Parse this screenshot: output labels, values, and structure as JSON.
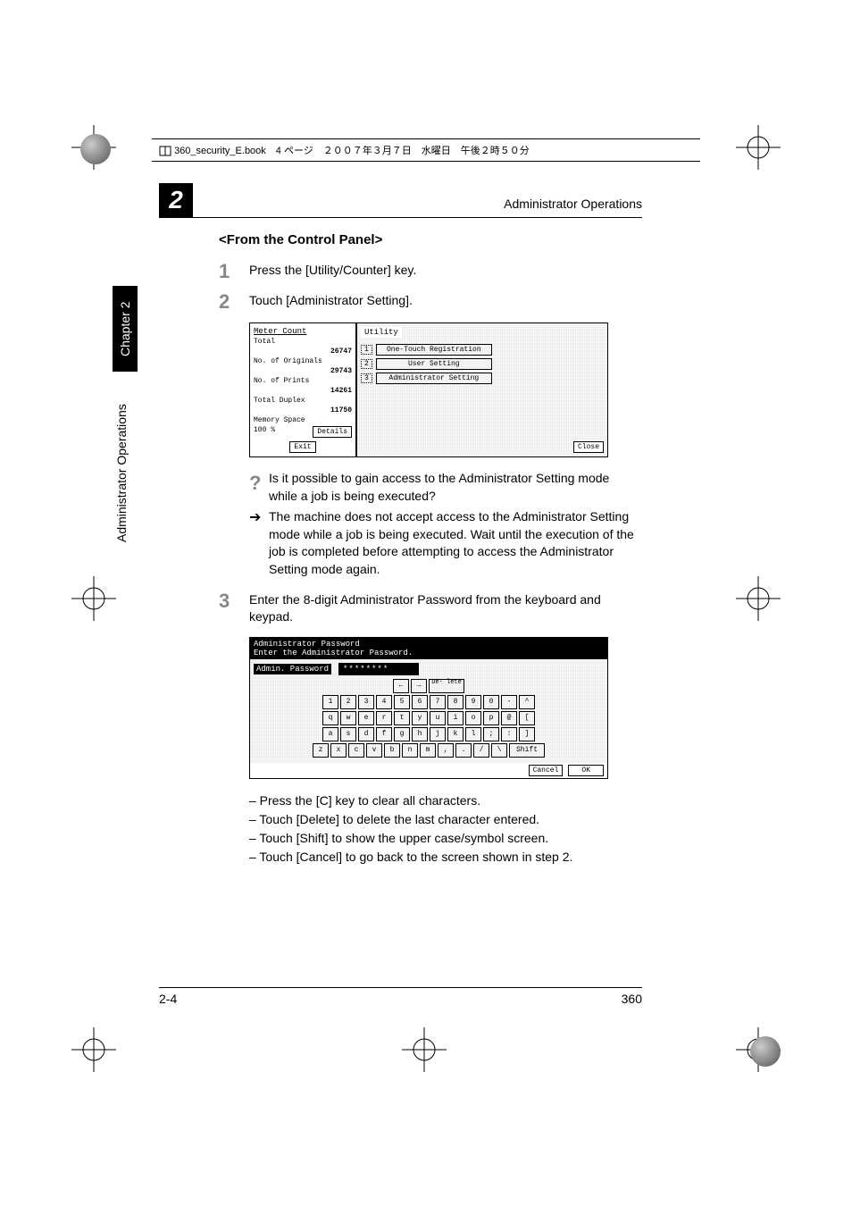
{
  "header_bar": "360_security_E.book　4 ページ　２００７年３月７日　水曜日　午後２時５０分",
  "chapter_number": "2",
  "running_header": "Administrator Operations",
  "side_tab": "Chapter 2",
  "side_text": "Administrator Operations",
  "section_title": "<From the Control Panel>",
  "steps": {
    "s1": {
      "num": "1",
      "text": "Press the [Utility/Counter] key."
    },
    "s2": {
      "num": "2",
      "text": "Touch [Administrator Setting]."
    },
    "s3": {
      "num": "3",
      "text": "Enter the 8-digit Administrator Password from the keyboard and keypad."
    }
  },
  "utility_screenshot": {
    "meter_title": "Meter Count",
    "total_lbl": "Total",
    "total_val": "26747",
    "orig_lbl": "No. of Originals",
    "orig_val": "29743",
    "prints_lbl": "No. of Prints",
    "prints_val": "14261",
    "duplex_lbl": "Total Duplex",
    "duplex_val": "11750",
    "mem_lbl": "Memory Space",
    "mem_val": "100 %",
    "details_btn": "Details",
    "exit_btn": "Exit",
    "right_title": "Utility",
    "item1": "One-Touch Registration",
    "item2": "User Setting",
    "item3": "Administrator Setting",
    "close_btn": "Close"
  },
  "qa": {
    "question": "Is it possible to gain access to the Administrator Setting mode while a job is being executed?",
    "answer": "The machine does not accept access to the Administrator Setting mode while a job is being executed. Wait until the execution of the job is completed before attempting to access the Administrator Setting mode again."
  },
  "pw_screenshot": {
    "title": "Administrator Password",
    "subtitle": "Enter the Administrator Password.",
    "label": "Admin. Password",
    "value": "********",
    "delete_btn": "De- lete",
    "arrow_l": "←",
    "arrow_r": "→",
    "shift_btn": "Shift",
    "cancel_btn": "Cancel",
    "ok_btn": "OK",
    "row_num": [
      "1",
      "2",
      "3",
      "4",
      "5",
      "6",
      "7",
      "8",
      "9",
      "0",
      "-",
      "^"
    ],
    "row_q": [
      "q",
      "w",
      "e",
      "r",
      "t",
      "y",
      "u",
      "i",
      "o",
      "p",
      "@",
      "["
    ],
    "row_a": [
      "a",
      "s",
      "d",
      "f",
      "g",
      "h",
      "j",
      "k",
      "l",
      ";",
      ":",
      "]"
    ],
    "row_z": [
      "z",
      "x",
      "c",
      "v",
      "b",
      "n",
      "m",
      ",",
      ".",
      "/",
      "\\"
    ]
  },
  "notes": {
    "n1": "–    Press the [C] key to clear all characters.",
    "n2": "–    Touch [Delete] to delete the last character entered.",
    "n3": "–    Touch [Shift] to show the upper case/symbol screen.",
    "n4": "–    Touch [Cancel] to go back to the screen shown in step 2."
  },
  "footer_left": "2-4",
  "footer_right": "360"
}
